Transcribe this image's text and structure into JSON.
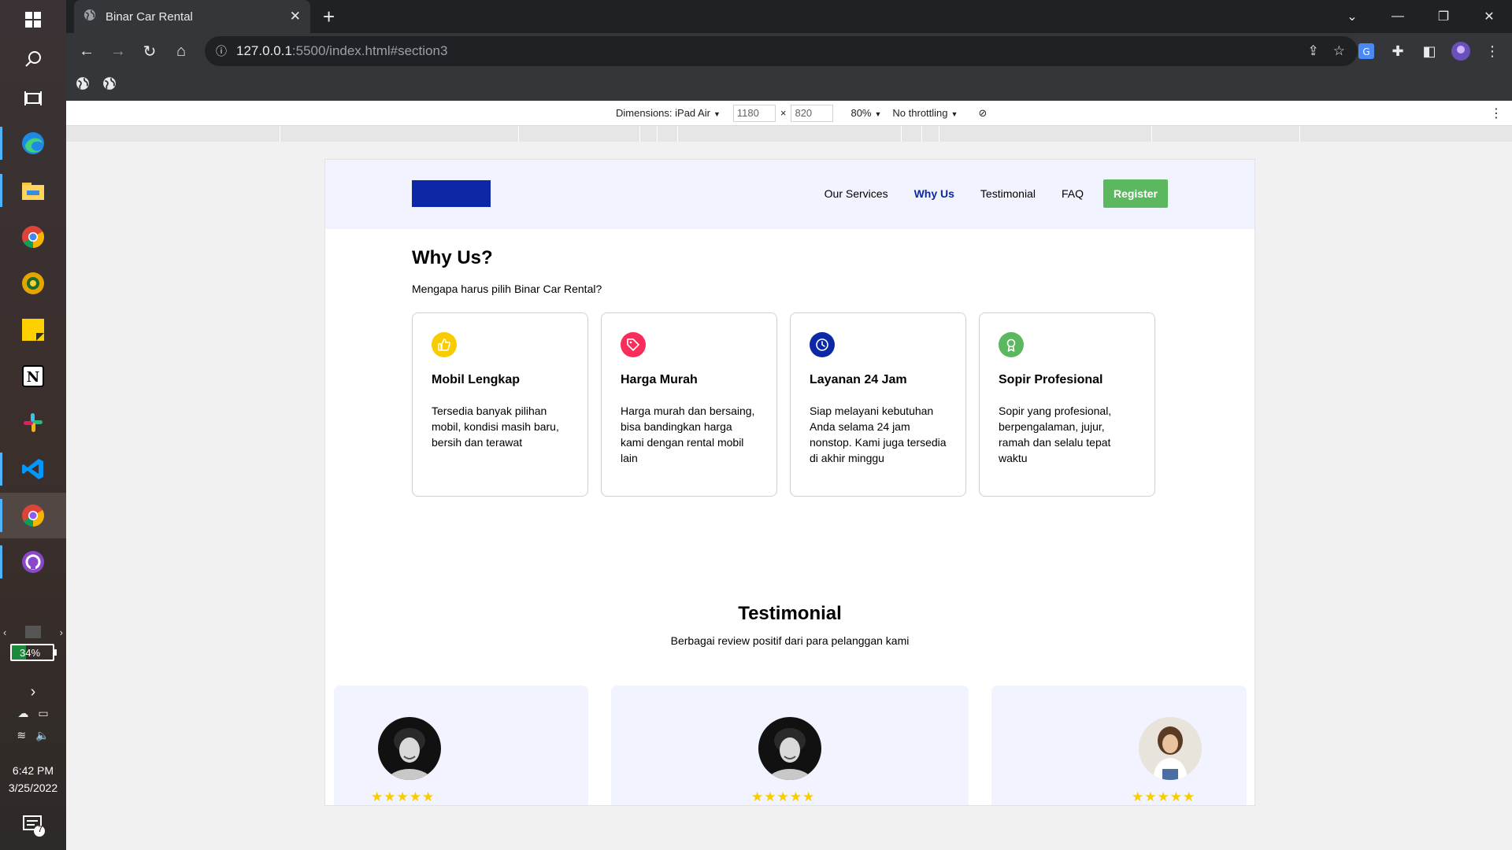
{
  "taskbar": {
    "apps": [
      "windows-start",
      "search",
      "task-view",
      "edge",
      "file-explorer",
      "chrome",
      "chrome-canary",
      "sticky-notes",
      "notion",
      "slack",
      "vscode",
      "chrome-active",
      "github-desktop"
    ],
    "battery_percent": "34%",
    "time": "6:42 PM",
    "date": "3/25/2022",
    "notification_count": "7"
  },
  "browser": {
    "tab_title": "Binar Car Rental",
    "url_host": "127.0.0.1",
    "url_path": ":5500/index.html#section3"
  },
  "devtools": {
    "dimensions_label": "Dimensions: iPad Air",
    "width": "1180",
    "height": "820",
    "times": "×",
    "zoom": "80%",
    "throttling": "No throttling"
  },
  "site": {
    "nav": {
      "services": "Our Services",
      "why_us": "Why Us",
      "testimonial": "Testimonial",
      "faq": "FAQ",
      "register": "Register"
    },
    "why_us": {
      "title": "Why Us?",
      "subtitle": "Mengapa harus pilih Binar Car Rental?",
      "cards": [
        {
          "icon": "thumbs-up-icon",
          "color": "#f9cc00",
          "title": "Mobil Lengkap",
          "text": "Tersedia banyak pilihan mobil, kondisi masih baru, bersih dan terawat"
        },
        {
          "icon": "price-tag-icon",
          "color": "#fa2c5a",
          "title": "Harga Murah",
          "text": "Harga murah dan bersaing, bisa bandingkan harga kami dengan rental mobil lain"
        },
        {
          "icon": "clock-icon",
          "color": "#0d28a6",
          "title": "Layanan 24 Jam",
          "text": "Siap melayani kebutuhan Anda selama 24 jam nonstop. Kami juga tersedia di akhir minggu"
        },
        {
          "icon": "award-icon",
          "color": "#5cb85f",
          "title": "Sopir Profesional",
          "text": "Sopir yang profesional, berpengalaman, jujur, ramah dan selalu tepat waktu"
        }
      ]
    },
    "testimonial": {
      "title": "Testimonial",
      "subtitle": "Berbagai review positif dari para pelanggan kami",
      "ratings": [
        5,
        5,
        5
      ],
      "stars": "★★★★★"
    }
  }
}
